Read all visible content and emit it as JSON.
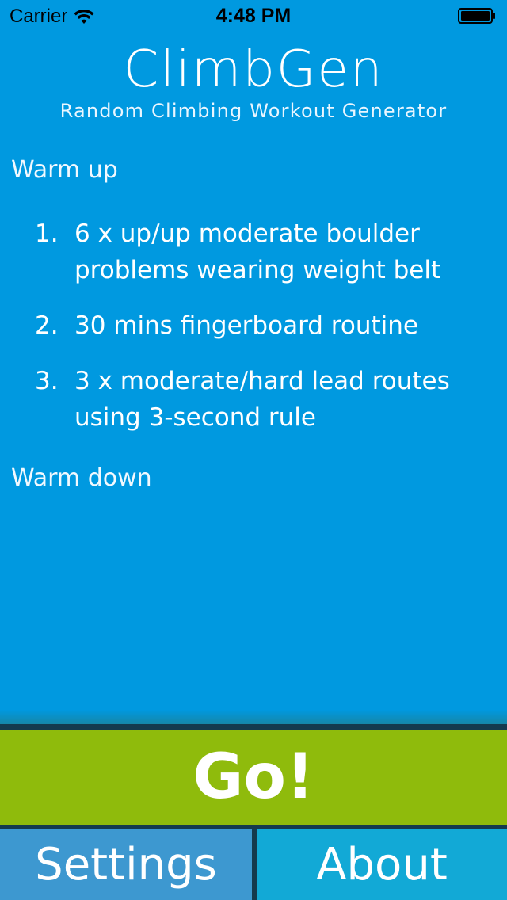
{
  "status_bar": {
    "carrier": "Carrier",
    "time": "4:48 PM",
    "icons": [
      "wifi-icon",
      "battery-icon"
    ]
  },
  "header": {
    "title": "ClimbGen",
    "subtitle": "Random Climbing Workout Generator"
  },
  "workout": {
    "warmup_label": "Warm up",
    "items": [
      {
        "number": "1.",
        "text": "6 x up/up moderate boulder problems wearing weight belt"
      },
      {
        "number": "2.",
        "text": "30 mins fingerboard routine"
      },
      {
        "number": "3.",
        "text": "3 x moderate/hard lead routes using 3-second rule"
      }
    ],
    "warmdown_label": "Warm down"
  },
  "actions": {
    "go_label": "Go!"
  },
  "tabs": {
    "settings_label": "Settings",
    "about_label": "About"
  },
  "colors": {
    "background": "#0099e0",
    "go_button": "#8fbb0c",
    "settings_tab": "#3d98d0",
    "about_tab": "#12a9d6",
    "divider": "#143a4e"
  }
}
